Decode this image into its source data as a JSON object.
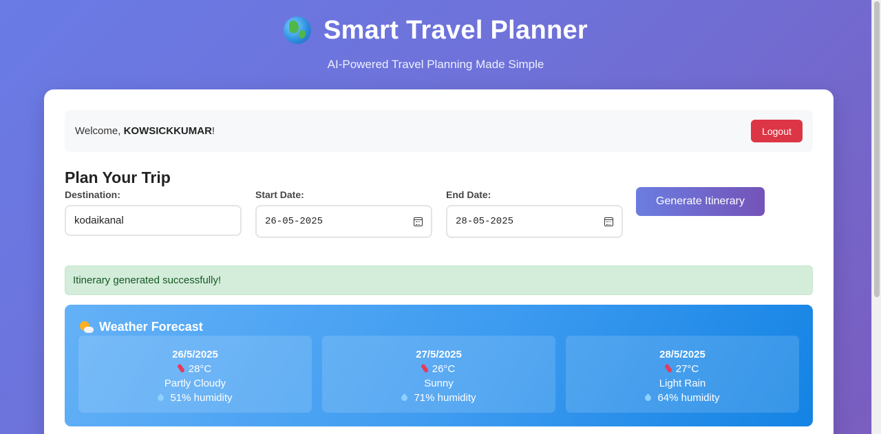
{
  "header": {
    "title": "Smart Travel Planner",
    "subtitle": "AI-Powered Travel Planning Made Simple",
    "icon": "globe-icon"
  },
  "welcome": {
    "prefix": "Welcome, ",
    "username": "KOWSICKKUMAR",
    "suffix": "!",
    "logout_label": "Logout"
  },
  "planner": {
    "heading": "Plan Your Trip",
    "destination": {
      "label": "Destination:",
      "value": "kodaikanal"
    },
    "start_date": {
      "label": "Start Date:",
      "value": "26-05-2025"
    },
    "end_date": {
      "label": "End Date:",
      "value": "28-05-2025"
    },
    "generate_label": "Generate Itinerary"
  },
  "status": {
    "message": "Itinerary generated successfully!"
  },
  "weather": {
    "title": "Weather Forecast",
    "days": [
      {
        "date": "26/5/2025",
        "temp": "28°C",
        "condition": "Partly Cloudy",
        "humidity": "51% humidity"
      },
      {
        "date": "27/5/2025",
        "temp": "26°C",
        "condition": "Sunny",
        "humidity": "71% humidity"
      },
      {
        "date": "28/5/2025",
        "temp": "27°C",
        "condition": "Light Rain",
        "humidity": "64% humidity"
      }
    ]
  },
  "colors": {
    "logout": "#dc3545",
    "success_bg": "#d4edda",
    "success_text": "#155724",
    "accent_start": "#6b7de0",
    "accent_end": "#7453b8"
  }
}
